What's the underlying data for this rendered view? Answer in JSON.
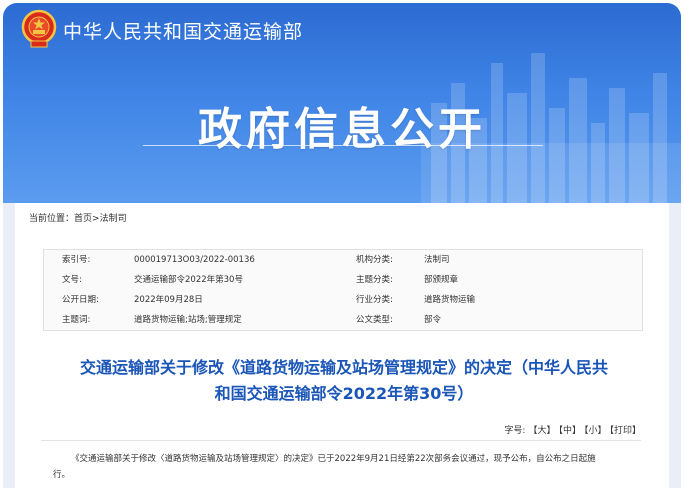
{
  "header": {
    "ministry_name": "中华人民共和国交通运输部",
    "page_heading": "政府信息公开"
  },
  "breadcrumb": {
    "prefix": "当前位置：",
    "home": "首页",
    "separator": " > ",
    "section": "法制司"
  },
  "meta": [
    {
      "label1": "索引号:",
      "value1": "000019713O03/2022-00136",
      "label2": "机构分类:",
      "value2": "法制司"
    },
    {
      "label1": "文号:",
      "value1": "交通运输部令2022年第30号",
      "label2": "主题分类:",
      "value2": "部颁规章"
    },
    {
      "label1": "公开日期:",
      "value1": "2022年09月28日",
      "label2": "行业分类:",
      "value2": "道路货物运输"
    },
    {
      "label1": "主题词:",
      "value1": "道路货物运输;站场;管理规定",
      "label2": "公文类型:",
      "value2": "部令"
    }
  ],
  "document": {
    "title_line1": "交通运输部关于修改《道路货物运输及站场管理规定》的决定（中华人民共",
    "title_line2": "和国交通运输部令2022年第30号）",
    "body_line1": "《交通运输部关于修改〈道路货物运输及站场管理规定〉的决定》已于2022年9月21日经第22次部务会议通过，现予公布，自公布之日起施",
    "body_line2": "行。"
  },
  "font_size": {
    "label": "字号:",
    "large": "【大】",
    "medium": "【中】",
    "small": "【小】",
    "print": "【打印】"
  },
  "colors": {
    "header_blue": "#3f84e6",
    "title_blue": "#1a55b8"
  },
  "icons": {
    "emblem": "national-emblem-icon"
  }
}
